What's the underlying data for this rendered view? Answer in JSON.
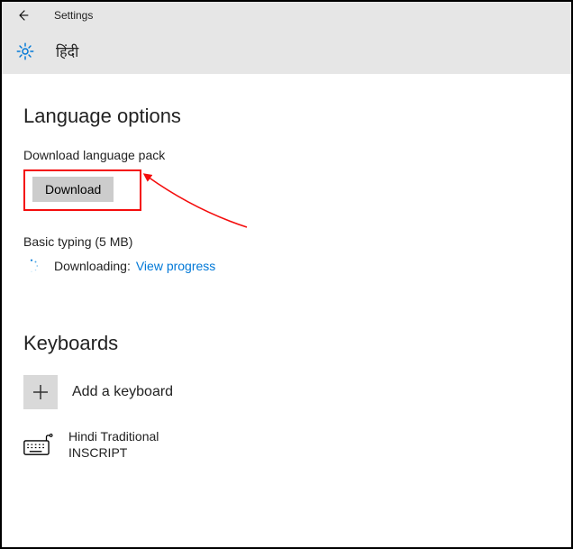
{
  "topbar": {
    "label": "Settings"
  },
  "header": {
    "language": "हिंदी"
  },
  "sections": {
    "language_options": {
      "title": "Language options",
      "download_pack_label": "Download language pack",
      "download_button": "Download",
      "basic_typing": "Basic typing (5 MB)",
      "downloading_label": "Downloading:",
      "view_progress": "View progress"
    },
    "keyboards": {
      "title": "Keyboards",
      "add_label": "Add a keyboard",
      "items": [
        {
          "name": "Hindi Traditional",
          "layout": "INSCRIPT"
        }
      ]
    }
  }
}
